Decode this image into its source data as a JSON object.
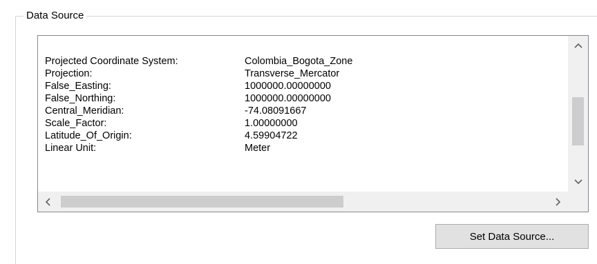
{
  "groupbox": {
    "title": "Data Source"
  },
  "properties": [
    {
      "key": "Projected Coordinate System:",
      "value": "Colombia_Bogota_Zone"
    },
    {
      "key": "Projection:",
      "value": "Transverse_Mercator"
    },
    {
      "key": "False_Easting:",
      "value": "1000000.00000000"
    },
    {
      "key": "False_Northing:",
      "value": "1000000.00000000"
    },
    {
      "key": "Central_Meridian:",
      "value": "-74.08091667"
    },
    {
      "key": "Scale_Factor:",
      "value": "1.00000000"
    },
    {
      "key": "Latitude_Of_Origin:",
      "value": "4.59904722"
    },
    {
      "key": "Linear Unit:",
      "value": "Meter"
    }
  ],
  "icons": {
    "scroll_up": "chevron-up-icon",
    "scroll_down": "chevron-down-icon",
    "scroll_left": "chevron-left-icon",
    "scroll_right": "chevron-right-icon"
  },
  "actions": {
    "set_data_source_label": "Set Data Source..."
  }
}
